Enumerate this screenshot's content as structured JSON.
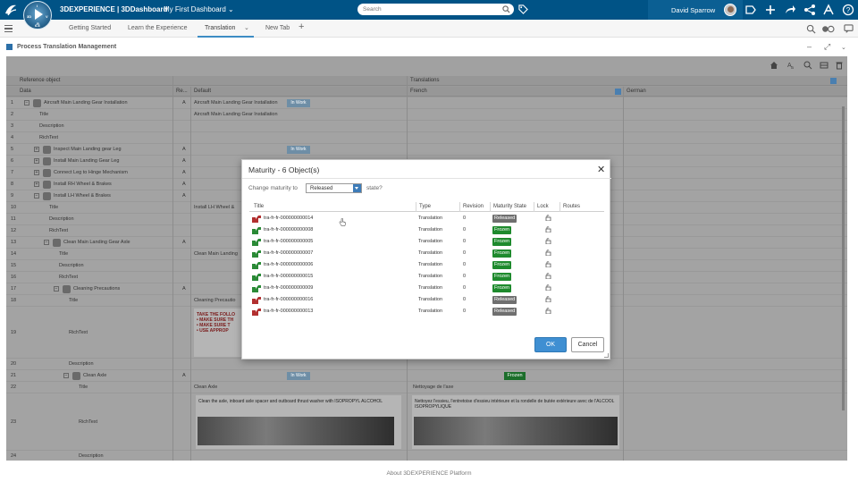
{
  "topbar": {
    "app_brand": "3DEXPERIENCE | 3DDashboard",
    "dashboard_name": "My First Dashboard",
    "search_placeholder": "Search",
    "user_name": "David Sparrow",
    "compass_version": "6.8",
    "compass_quadrant_labels": [
      "3D",
      "V",
      "i",
      "R"
    ]
  },
  "tabs": {
    "items": [
      "Getting Started",
      "Learn the Experience",
      "Translation",
      "New Tab"
    ],
    "active": "Translation"
  },
  "widget": {
    "title": "Process Translation Management"
  },
  "grid": {
    "group_headers": {
      "reference": "Reference object",
      "translations": "Translations"
    },
    "columns": {
      "data": "Data",
      "revision": "Re...",
      "default": "Default",
      "french": "French",
      "german": "German"
    },
    "rows": [
      {
        "num": "1",
        "label": "Aircraft Main Landing Gear Installation",
        "rev": "A",
        "default": "Aircraft Main Landing Gear Installation",
        "state": "In Work"
      },
      {
        "num": "2",
        "label": "Title",
        "rev": "",
        "default": "Aircraft Main Landing Gear Installation"
      },
      {
        "num": "3",
        "label": "Description",
        "rev": "",
        "default": ""
      },
      {
        "num": "4",
        "label": "RichText",
        "rev": "",
        "default": ""
      },
      {
        "num": "5",
        "label": "Inspect Main Landing gear Leg",
        "rev": "A",
        "default": "",
        "state": "In Work"
      },
      {
        "num": "6",
        "label": "Install Main Landing Gear Leg",
        "rev": "A",
        "default": ""
      },
      {
        "num": "7",
        "label": "Connect Leg to Hinge Mechanism",
        "rev": "A",
        "default": ""
      },
      {
        "num": "8",
        "label": "Install RH Wheel & Brakes",
        "rev": "A",
        "default": ""
      },
      {
        "num": "9",
        "label": "Install LH Wheel & Brakes",
        "rev": "A",
        "default": ""
      },
      {
        "num": "10",
        "label": "Title",
        "rev": "",
        "default": "Install LH Wheel &"
      },
      {
        "num": "11",
        "label": "Description",
        "rev": "",
        "default": ""
      },
      {
        "num": "12",
        "label": "RichText",
        "rev": "",
        "default": ""
      },
      {
        "num": "13",
        "label": "Clean Main Landing Gear Axle",
        "rev": "A",
        "default": ""
      },
      {
        "num": "14",
        "label": "Title",
        "rev": "",
        "default": "Clean Main Landing"
      },
      {
        "num": "15",
        "label": "Description",
        "rev": "",
        "default": ""
      },
      {
        "num": "16",
        "label": "RichText",
        "rev": "",
        "default": ""
      },
      {
        "num": "17",
        "label": "Cleaning Precautions",
        "rev": "A",
        "default": ""
      },
      {
        "num": "18",
        "label": "Title",
        "rev": "",
        "default": "Cleaning Precautio"
      },
      {
        "num": "19",
        "label": "RichText",
        "rev": "",
        "default": ""
      },
      {
        "num": "20",
        "label": "Description",
        "rev": "",
        "default": ""
      },
      {
        "num": "21",
        "label": "Clean Axle",
        "rev": "A",
        "default": "",
        "state": "In Work",
        "german_state": "Frozen"
      },
      {
        "num": "22",
        "label": "Title",
        "rev": "",
        "default": "Clean Axle",
        "french": "Nettoyage de l'axe"
      },
      {
        "num": "23",
        "label": "RichText",
        "rev": "",
        "default": "Clean the axle, inboard axle spacer and outboard thrust washer with ISOPROPYL ALCOHOL",
        "french": "Nettoyez l'essieu, l'entretoise d'essieu intérieure et la rondelle de butée extérieure avec de l'ALCOOL ISOPROPYLIQUE"
      },
      {
        "num": "24",
        "label": "Description",
        "rev": "",
        "default": ""
      }
    ],
    "richtext_warning": [
      "TAKE THE FOLLO",
      "• MAKE SURE TH",
      "• MAKE SURE T",
      "• USE APPROP"
    ]
  },
  "modal": {
    "title": "Maturity - 6 Object(s)",
    "change_label": "Change maturity to",
    "selected_state": "Released",
    "state_suffix": "state?",
    "columns": {
      "title": "Title",
      "type": "Type",
      "revision": "Revision",
      "maturity": "Maturity State",
      "lock": "Lock",
      "routes": "Routes"
    },
    "rows": [
      {
        "title": "tra-fr-fr-000000000014",
        "type": "Translation",
        "revision": "0",
        "state": "Released"
      },
      {
        "title": "tra-fr-fr-000000000008",
        "type": "Translation",
        "revision": "0",
        "state": "Frozen"
      },
      {
        "title": "tra-fr-fr-000000000005",
        "type": "Translation",
        "revision": "0",
        "state": "Frozen"
      },
      {
        "title": "tra-fr-fr-000000000007",
        "type": "Translation",
        "revision": "0",
        "state": "Frozen"
      },
      {
        "title": "tra-fr-fr-000000000006",
        "type": "Translation",
        "revision": "0",
        "state": "Frozen"
      },
      {
        "title": "tra-fr-fr-000000000015",
        "type": "Translation",
        "revision": "0",
        "state": "Frozen"
      },
      {
        "title": "tra-fr-fr-000000000009",
        "type": "Translation",
        "revision": "0",
        "state": "Frozen"
      },
      {
        "title": "tra-fr-fr-000000000016",
        "type": "Translation",
        "revision": "0",
        "state": "Released"
      },
      {
        "title": "tra-fr-fr-000000000013",
        "type": "Translation",
        "revision": "0",
        "state": "Released"
      }
    ],
    "ok_label": "OK",
    "cancel_label": "Cancel"
  },
  "footer": {
    "text": "About 3DEXPERIENCE Platform"
  },
  "colors": {
    "topbar": "#005386",
    "released": "#6f6f6f",
    "frozen": "#1e8a2d",
    "in_work": "#6e8ea6",
    "accent": "#3f8fd2"
  }
}
